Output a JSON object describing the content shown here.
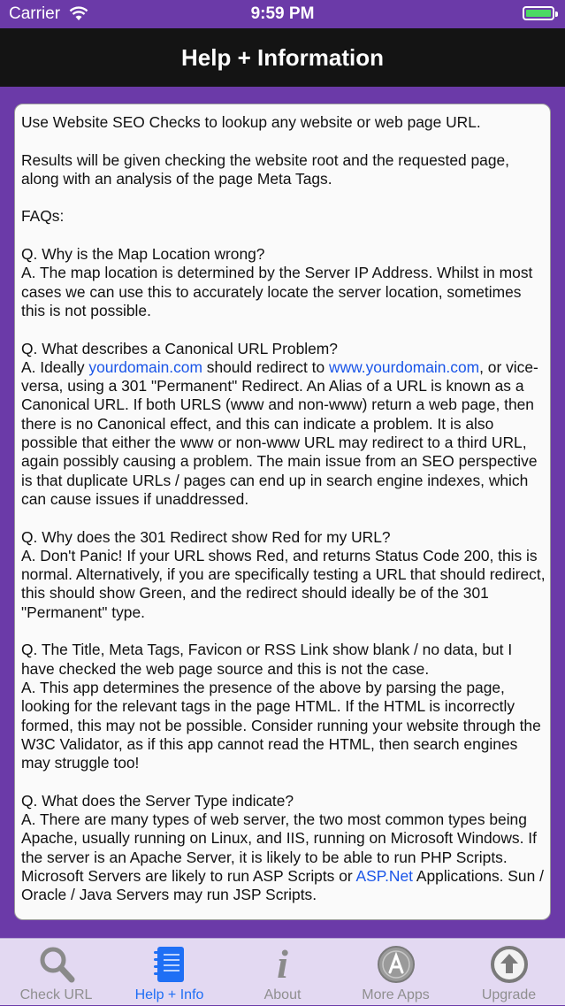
{
  "status": {
    "carrier": "Carrier",
    "time": "9:59 PM"
  },
  "nav": {
    "title": "Help + Information"
  },
  "help": {
    "intro": "Use Website SEO Checks to lookup any website or web page URL.",
    "results": "Results will be given checking the website root and the requested page, along with an analysis of the page Meta Tags.",
    "faqs_heading": "FAQs:",
    "q1": "Q. Why is the Map Location wrong?",
    "a1": "A. The map location is determined by the Server IP Address. Whilst in most cases we can use this to accurately locate the server location, sometimes this is not possible.",
    "q2": "Q. What describes a Canonical URL Problem?",
    "a2_part1": "A. Ideally ",
    "a2_link1": "yourdomain.com",
    "a2_part2": " should redirect to ",
    "a2_link2": "www.yourdomain.com",
    "a2_part3": ", or vice-versa, using a 301 \"Permanent\" Redirect. An Alias of a URL is known as a Canonical URL. If both URLS (www and non-www) return a web page, then there is no Canonical effect, and this can indicate a problem. It is also possible that either the www or non-www URL may redirect to a third URL, again possibly causing a problem. The main issue from an SEO perspective is that duplicate URLs / pages can end up in search engine indexes, which can cause issues if unaddressed.",
    "q3": "Q. Why does the 301 Redirect show Red for my URL?",
    "a3": "A. Don't Panic! If your URL shows Red, and returns Status Code 200, this is normal. Alternatively, if you are specifically testing a URL that should redirect, this should show Green, and the redirect should ideally be of the 301 \"Permanent\" type.",
    "q4": "Q. The Title, Meta Tags, Favicon or RSS Link show blank / no data, but I have checked the web page source and this is not the case.",
    "a4": "A. This app determines the presence of the above by parsing the page, looking for the relevant  tags in the page HTML. If the HTML is incorrectly formed, this may not be possible. Consider running your website through the W3C Validator, as if this app cannot read the HTML, then search engines may struggle too!",
    "q5": "Q. What does the Server Type indicate?",
    "a5_part1": "A. There are many types of web server, the two most common types being Apache, usually running on Linux, and IIS, running on Microsoft Windows. If the server is an Apache Server, it is likely to be able to run PHP Scripts. Microsoft Servers are likely to run ASP Scripts or ",
    "a5_link": "ASP.Net",
    "a5_part2": " Applications. Sun / Oracle / Java Servers may run JSP Scripts."
  },
  "tabs": [
    {
      "label": "Check URL",
      "icon": "magnifier-icon"
    },
    {
      "label": "Help + Info",
      "icon": "notebook-icon",
      "active": true
    },
    {
      "label": "About",
      "icon": "info-icon"
    },
    {
      "label": "More Apps",
      "icon": "app-store-icon"
    },
    {
      "label": "Upgrade",
      "icon": "upgrade-arrow-icon"
    }
  ],
  "colors": {
    "accent": "#6b3aa8",
    "active_tab": "#1f6ff5",
    "link": "#1a55e8"
  }
}
